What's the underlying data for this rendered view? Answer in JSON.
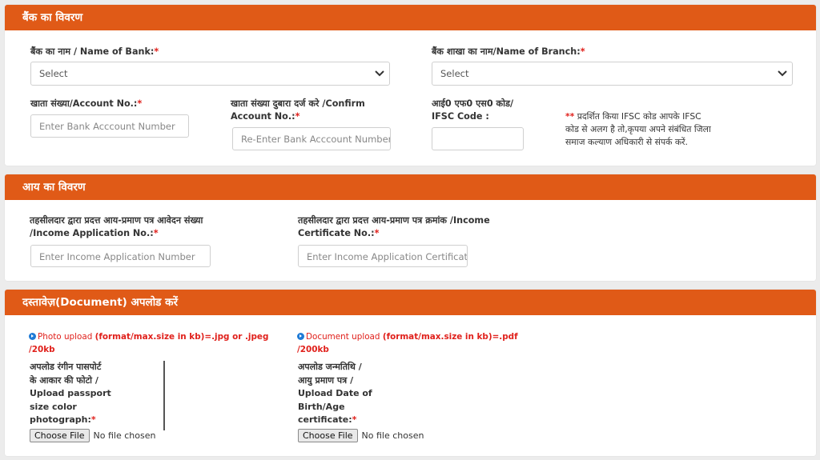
{
  "bank": {
    "title": "बैंक का विवरण",
    "bank_name_label": "बैंक का नाम / Name of Bank:",
    "bank_select_value": "Select",
    "branch_label": "बैंक शाखा का नाम/Name of Branch:",
    "branch_select_value": "Select",
    "account_label": "खाता संख्या/Account No.:",
    "account_placeholder": "Enter Bank Acccount Number",
    "confirm_label_line1": "खाता संख्या दुबारा दर्ज करे /Confirm",
    "confirm_label_line2": "Account No.:",
    "confirm_placeholder": "Re-Enter Bank Acccount Number",
    "ifsc_label_line1": "आई0 एफ0 एस0 कोड/",
    "ifsc_label_line2": "IFSC Code :",
    "ifsc_value": "",
    "ifsc_note_stars": "**",
    "ifsc_note_line1": " प्रदर्शित किया IFSC कोड आपके IFSC",
    "ifsc_note_line2": "कोड से अलग है तो,कृपया अपने संबंधित जिला",
    "ifsc_note_line3": "समाज कल्याण अधिकारी से संपर्क करें."
  },
  "income": {
    "title": "आय का विवरण",
    "app_label_line1": "तहसीलदार द्वारा प्रदत्त आय-प्रमाण पत्र आवेदन संख्या",
    "app_label_line2": "/Income Application No.:",
    "app_placeholder": "Enter Income Application Number",
    "cert_label_line1": "तहसीलदार द्वारा प्रदत्त आय-प्रमाण पत्र क्रमांक /Income",
    "cert_label_line2": "Certificate No.:",
    "cert_placeholder": "Enter Income Application Certificate Number"
  },
  "documents": {
    "title": "दस्तावेज़(Document) अपलोड करें",
    "photo": {
      "info_prefix": "Photo upload ",
      "info_format": "(format/max.size in kb)=.jpg or .jpeg",
      "info_line2": "/20kb",
      "label_lines": [
        "अपलोड रंगीन पासपोर्ट",
        "के आकार की फोटो /",
        "Upload passport",
        "size color",
        "photograph:"
      ],
      "button": "Choose File",
      "status": "No file chosen"
    },
    "dob": {
      "info_prefix": "Document upload ",
      "info_format": "(format/max.size in kb)=.pdf",
      "info_line2": "/200kb",
      "label_lines": [
        "अपलोड जन्मतिथि /",
        "आयु प्रमाण पत्र /",
        "Upload Date of",
        "Birth/Age",
        "certificate:"
      ],
      "button": "Choose File",
      "status": "No file chosen"
    }
  },
  "required_mark": "*",
  "colors": {
    "header_orange": "#e05a17",
    "required_red": "#e0201b",
    "info_blue": "#1e7ad6"
  }
}
